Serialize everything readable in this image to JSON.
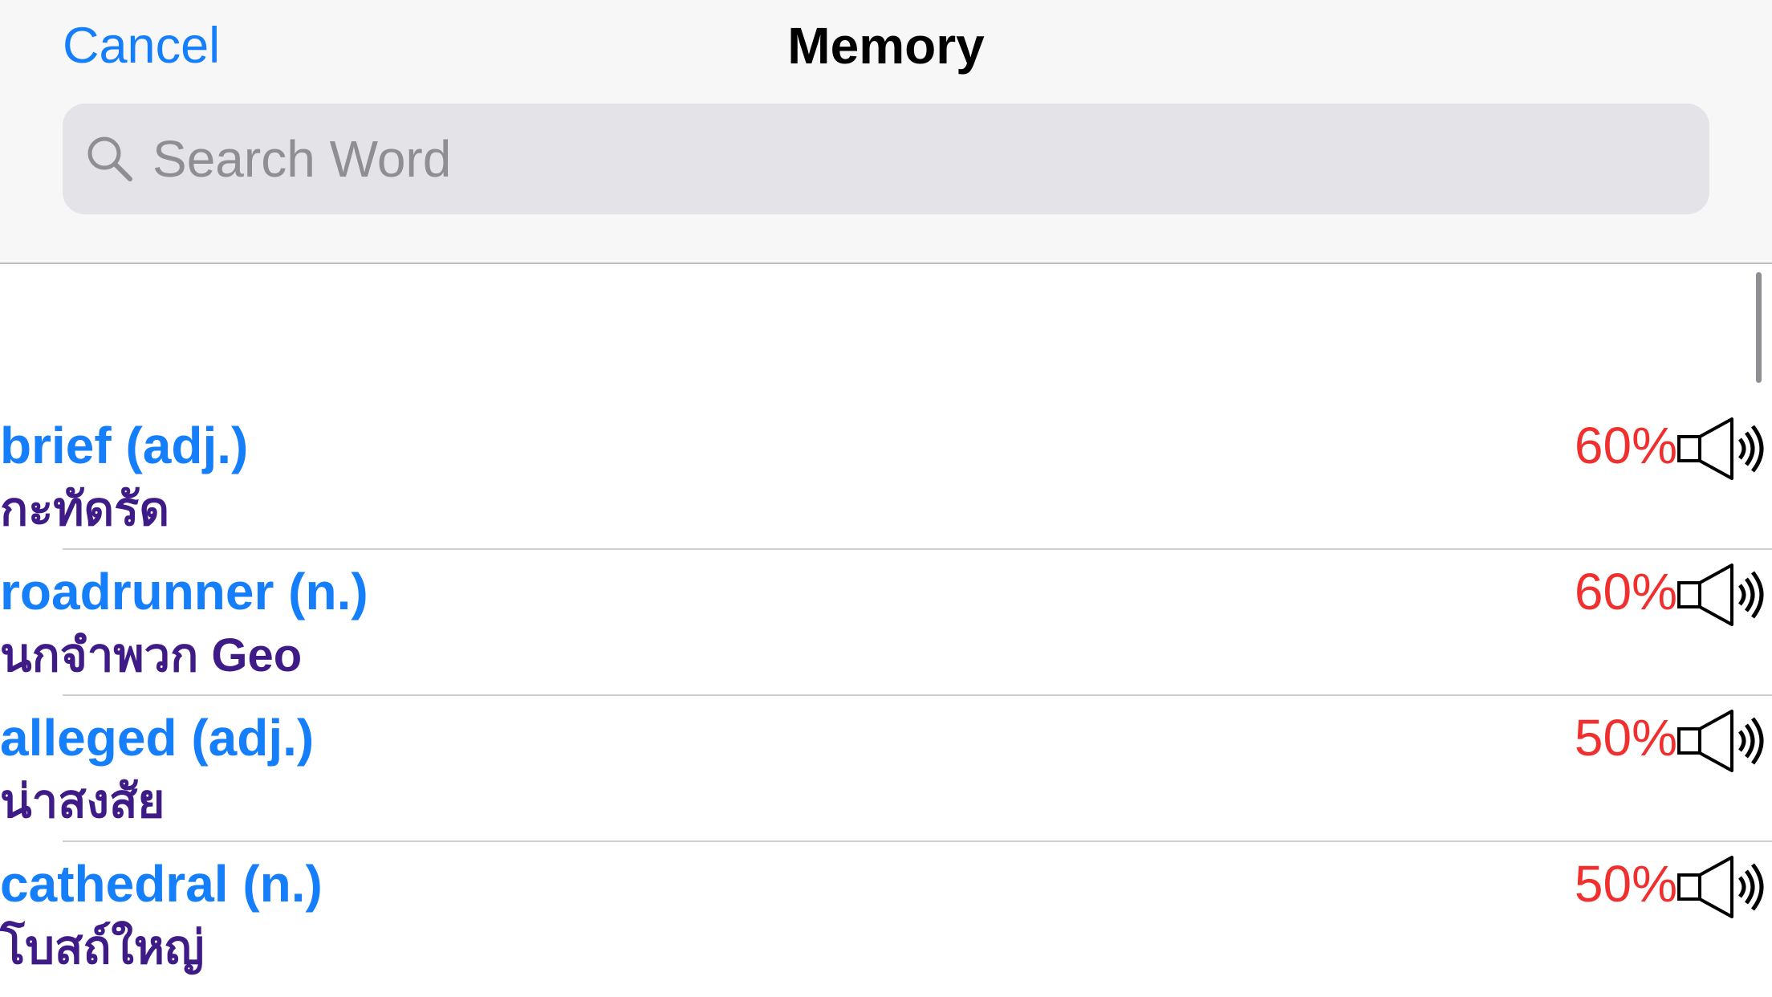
{
  "header": {
    "cancel_label": "Cancel",
    "title": "Memory",
    "search_placeholder": "Search Word",
    "search_value": ""
  },
  "icons": {
    "search": "search-icon",
    "speaker": "speaker-icon"
  },
  "colors": {
    "accent": "#147efb",
    "meaning": "#3e1b86",
    "percent": "#f0302f"
  },
  "words": [
    {
      "word": "brief (adj.)",
      "meaning": "กะทัดรัด",
      "percent": "60%"
    },
    {
      "word": "roadrunner (n.)",
      "meaning": "นกจำพวก Geo",
      "percent": "60%"
    },
    {
      "word": "alleged (adj.)",
      "meaning": "น่าสงสัย",
      "percent": "50%"
    },
    {
      "word": "cathedral (n.)",
      "meaning": "โบสถ์ใหญ่",
      "percent": "50%"
    }
  ]
}
